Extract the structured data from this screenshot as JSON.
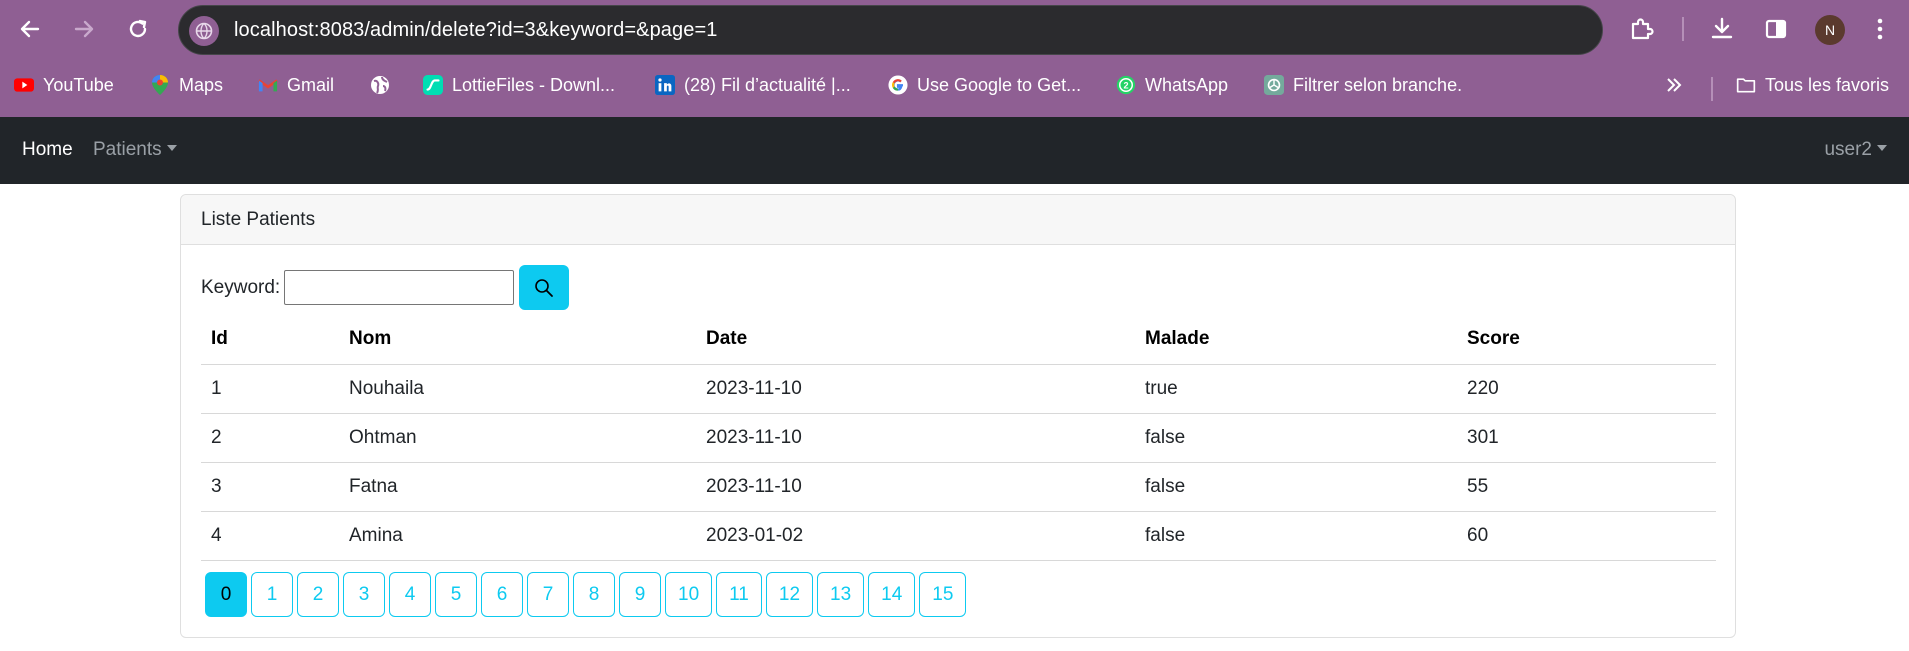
{
  "browser": {
    "url": "localhost:8083/admin/delete?id=3&keyword=&page=1",
    "profile_initial": "N",
    "bookmarks": [
      {
        "label": "YouTube",
        "icon": "youtube-icon"
      },
      {
        "label": "Maps",
        "icon": "maps-icon"
      },
      {
        "label": "Gmail",
        "icon": "gmail-icon"
      },
      {
        "label": "",
        "icon": "globe-icon"
      },
      {
        "label": "LottieFiles - Downl...",
        "icon": "lottiefiles-icon"
      },
      {
        "label": "(28) Fil d’actualité |...",
        "icon": "linkedin-icon"
      },
      {
        "label": "Use Google to Get...",
        "icon": "google-icon"
      },
      {
        "label": "WhatsApp",
        "icon": "whatsapp-icon"
      },
      {
        "label": "Filtrer selon branche.",
        "icon": "chatgpt-icon"
      }
    ],
    "all_bookmarks_label": "Tous les favoris"
  },
  "navbar": {
    "home": "Home",
    "patients": "Patients",
    "user": "user2"
  },
  "card": {
    "title": "Liste Patients",
    "search_label": "Keyword:",
    "search_value": ""
  },
  "table": {
    "headers": [
      "Id",
      "Nom",
      "Date",
      "Malade",
      "Score"
    ],
    "rows": [
      [
        "1",
        "Nouhaila",
        "2023-11-10",
        "true",
        "220"
      ],
      [
        "2",
        "Ohtman",
        "2023-11-10",
        "false",
        "301"
      ],
      [
        "3",
        "Fatna",
        "2023-11-10",
        "false",
        "55"
      ],
      [
        "4",
        "Amina",
        "2023-01-02",
        "false",
        "60"
      ]
    ]
  },
  "pagination": {
    "pages": [
      "0",
      "1",
      "2",
      "3",
      "4",
      "5",
      "6",
      "7",
      "8",
      "9",
      "10",
      "11",
      "12",
      "13",
      "14",
      "15"
    ],
    "active": "0"
  },
  "colors": {
    "chrome": "#8f5f93",
    "navbar": "#212529",
    "accent": "#0dcaf0"
  }
}
